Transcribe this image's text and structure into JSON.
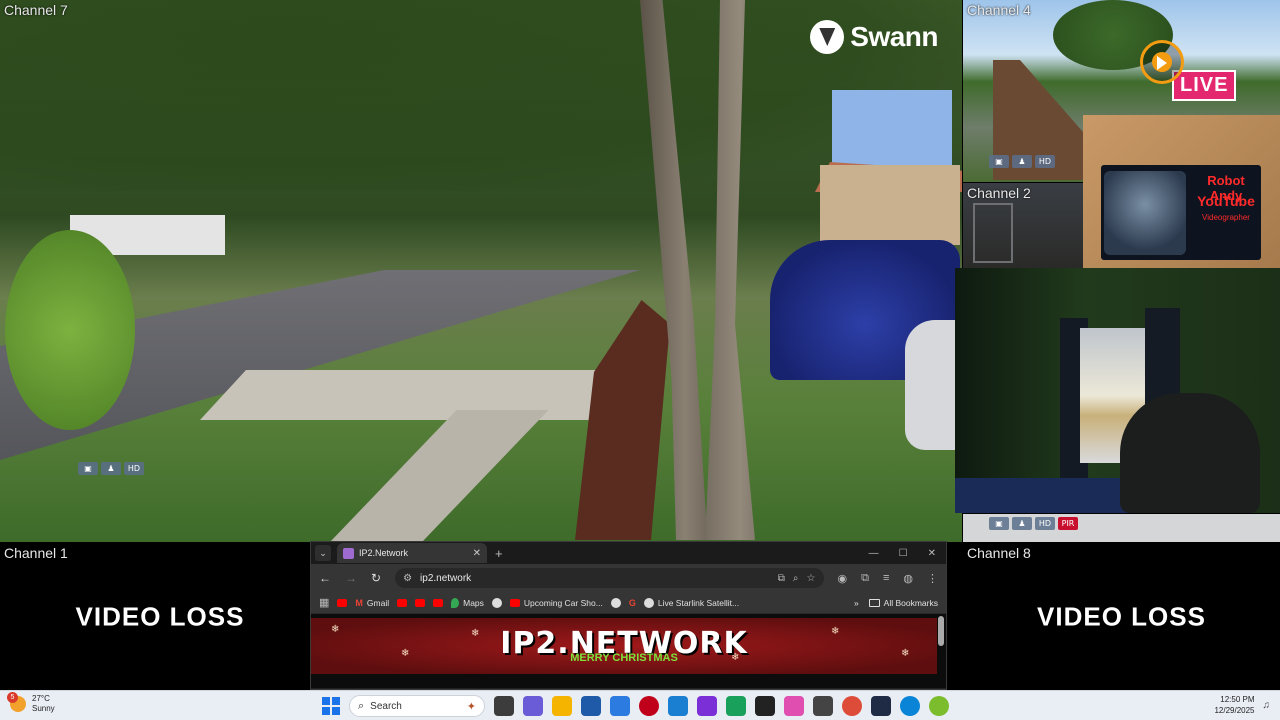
{
  "nvr": {
    "brand": "Swann",
    "channels": {
      "ch7": "Channel 7",
      "ch4": "Channel 4",
      "ch2": "Channel 2",
      "ch1": "Channel 1",
      "ch8": "Channel 8"
    },
    "video_loss": "VIDEO LOSS",
    "status_icons": [
      "cam",
      "motion",
      "HD"
    ],
    "pir": "PIR"
  },
  "overlay": {
    "live": "LIVE",
    "promo_line1": "Robot Andy",
    "promo_line2": "YouTube",
    "promo_line3": "Videographer"
  },
  "browser": {
    "tab_title": "IP2.Network",
    "url": "ip2.network",
    "bookmarks": [
      "Gmail",
      "Maps",
      "Upcoming Car Sho...",
      "Live Starlink Satellit..."
    ],
    "all_bookmarks": "All Bookmarks",
    "banner_title": "IP2.NETWORK",
    "banner_sub": "MERRY CHRISTMAS"
  },
  "taskbar": {
    "weather_badge": "5",
    "temperature": "27°C",
    "condition": "Sunny",
    "search_placeholder": "Search",
    "time": "12:50 PM",
    "date": "12/29/2025"
  }
}
